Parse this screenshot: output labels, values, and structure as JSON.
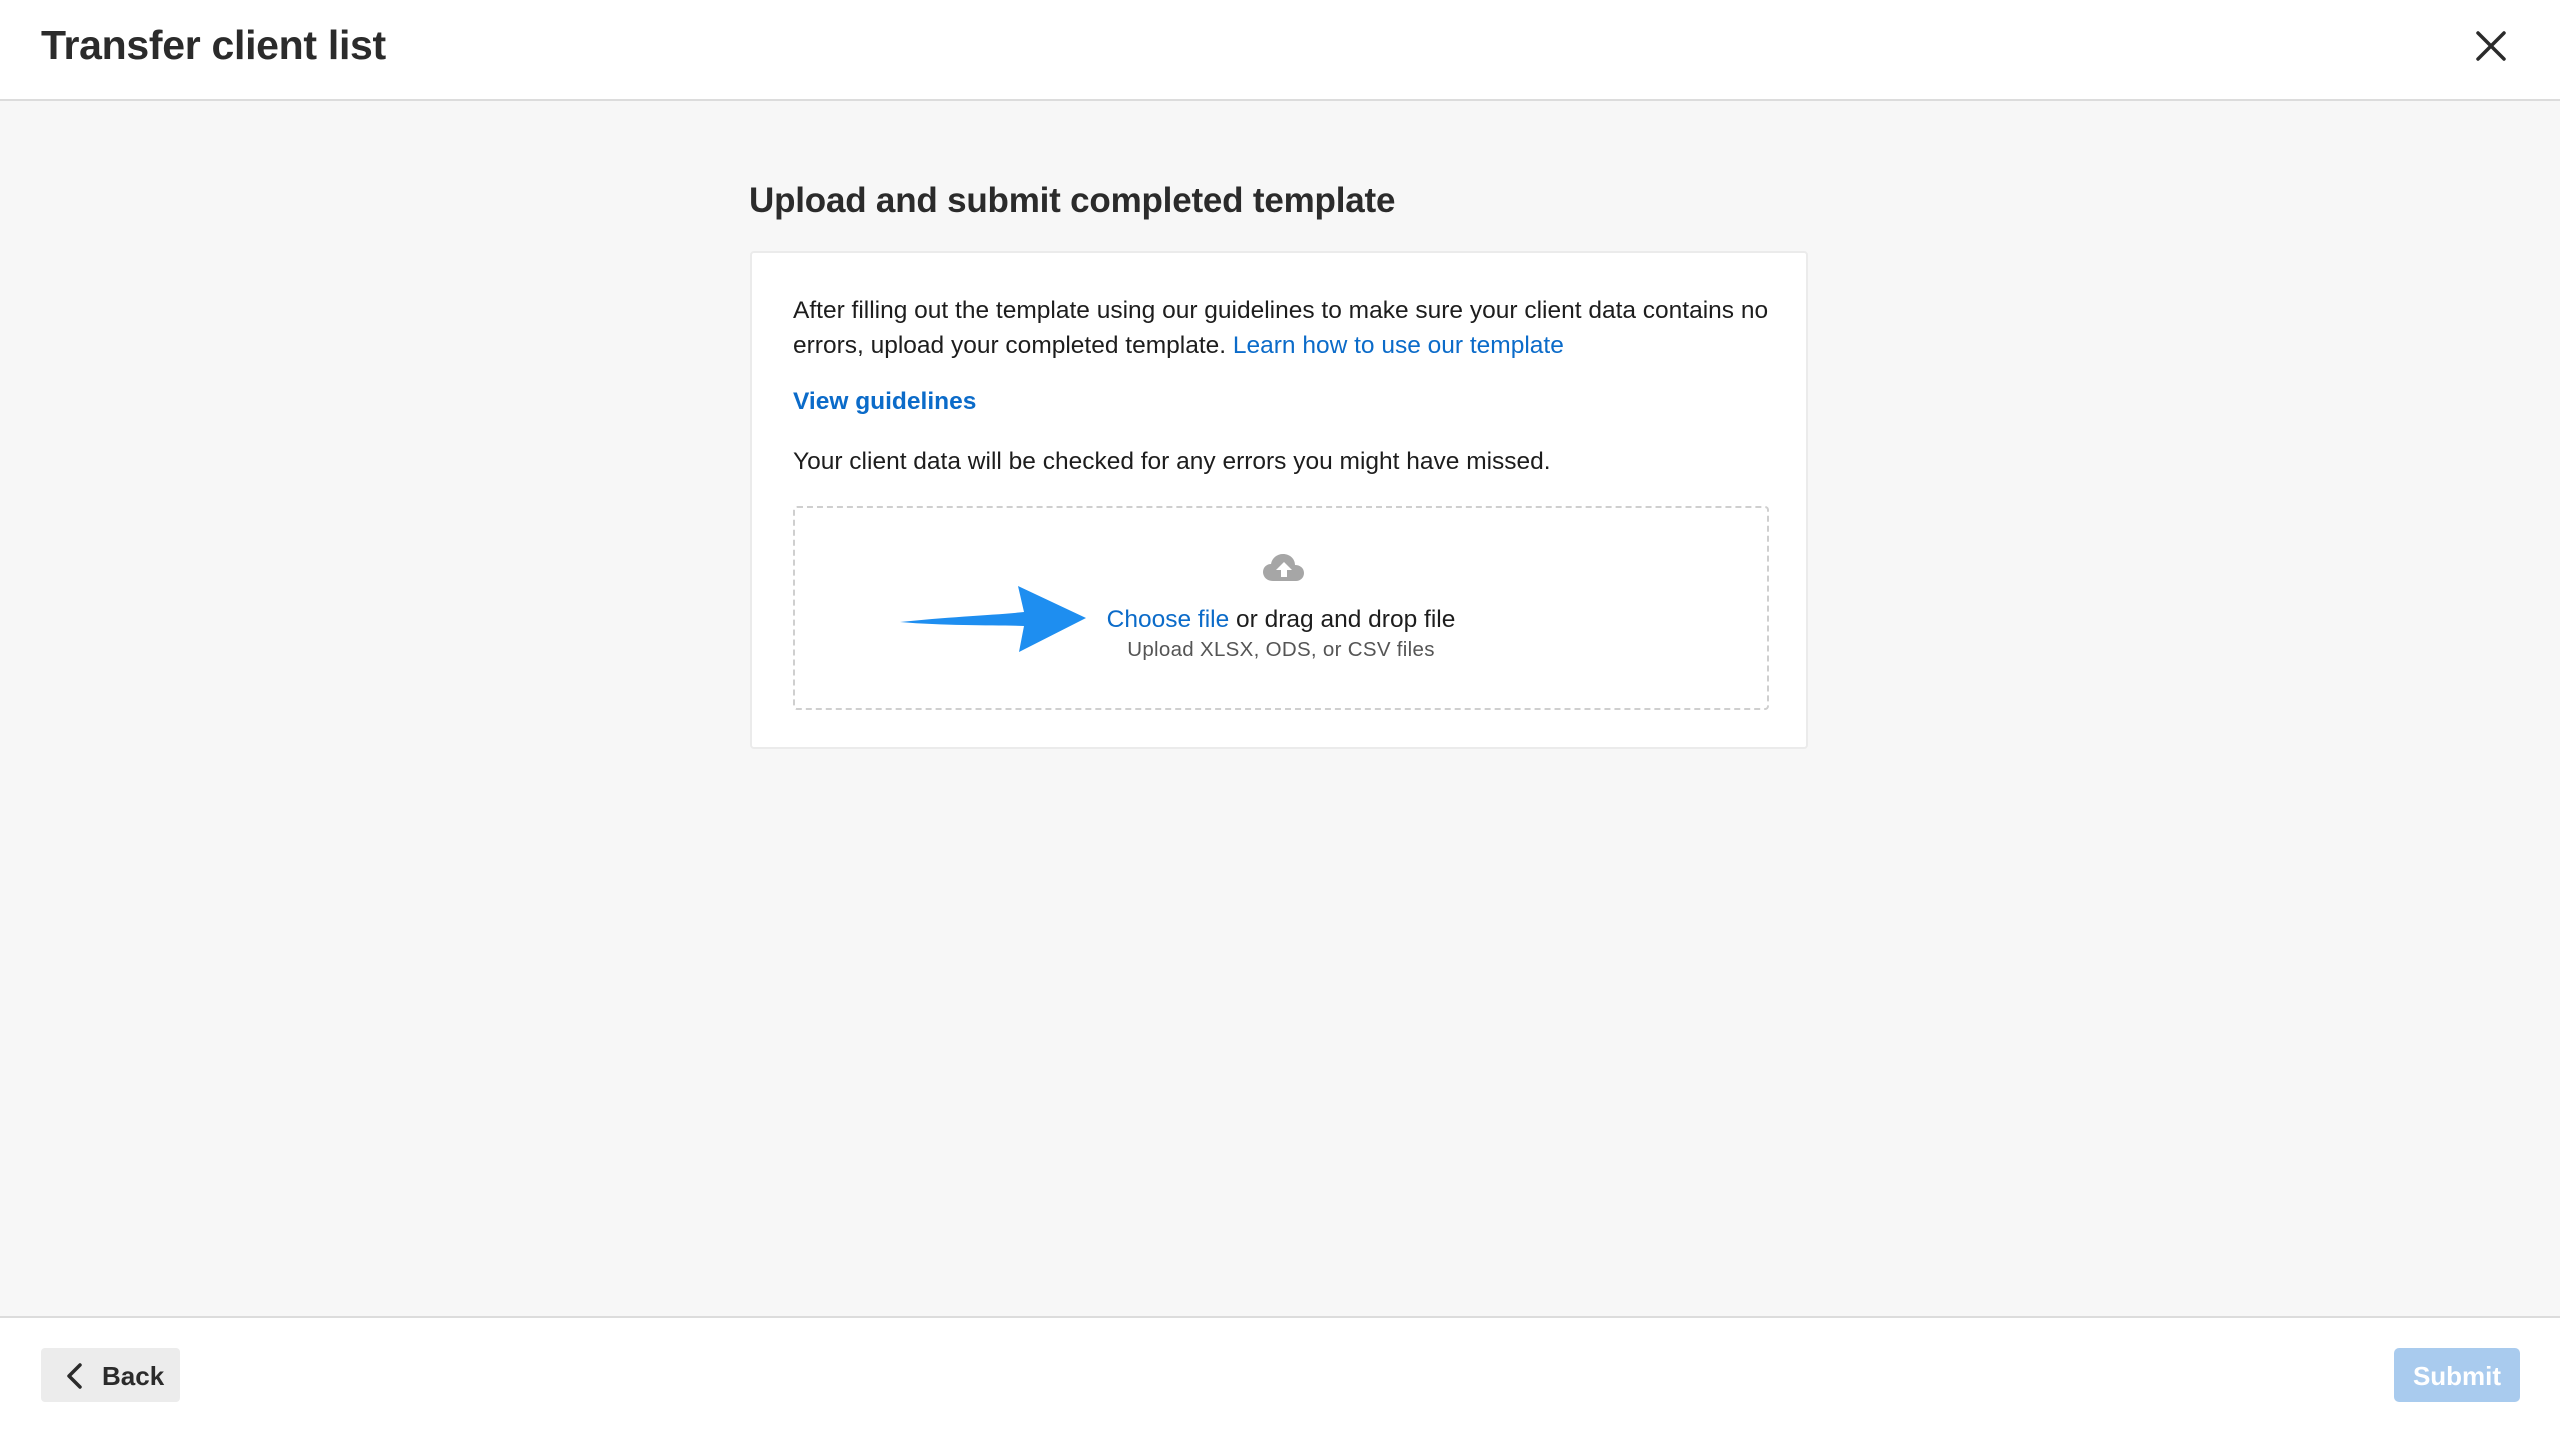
{
  "header": {
    "title": "Transfer client list",
    "close_icon": "close-icon"
  },
  "main": {
    "section_title": "Upload and submit completed template",
    "intro_text": "After filling out the template using our guidelines to make sure your client data contains no errors, upload your completed template.",
    "learn_link": "Learn how to use our template",
    "guidelines_link": "View guidelines",
    "check_text": "Your client data will be checked for any errors you might have missed.",
    "dropzone": {
      "icon": "cloud-upload-icon",
      "choose_label": "Choose file",
      "drag_text": "or drag and drop file",
      "file_types": "Upload XLSX, ODS, or CSV files"
    },
    "annotation": {
      "icon": "arrow-right-icon",
      "color": "#1e8ef0"
    }
  },
  "footer": {
    "back_label": "Back",
    "back_icon": "chevron-left-icon",
    "submit_label": "Submit"
  },
  "colors": {
    "link": "#0b6bc9",
    "submit_disabled": "#a9cbee",
    "background": "#f7f7f7"
  }
}
